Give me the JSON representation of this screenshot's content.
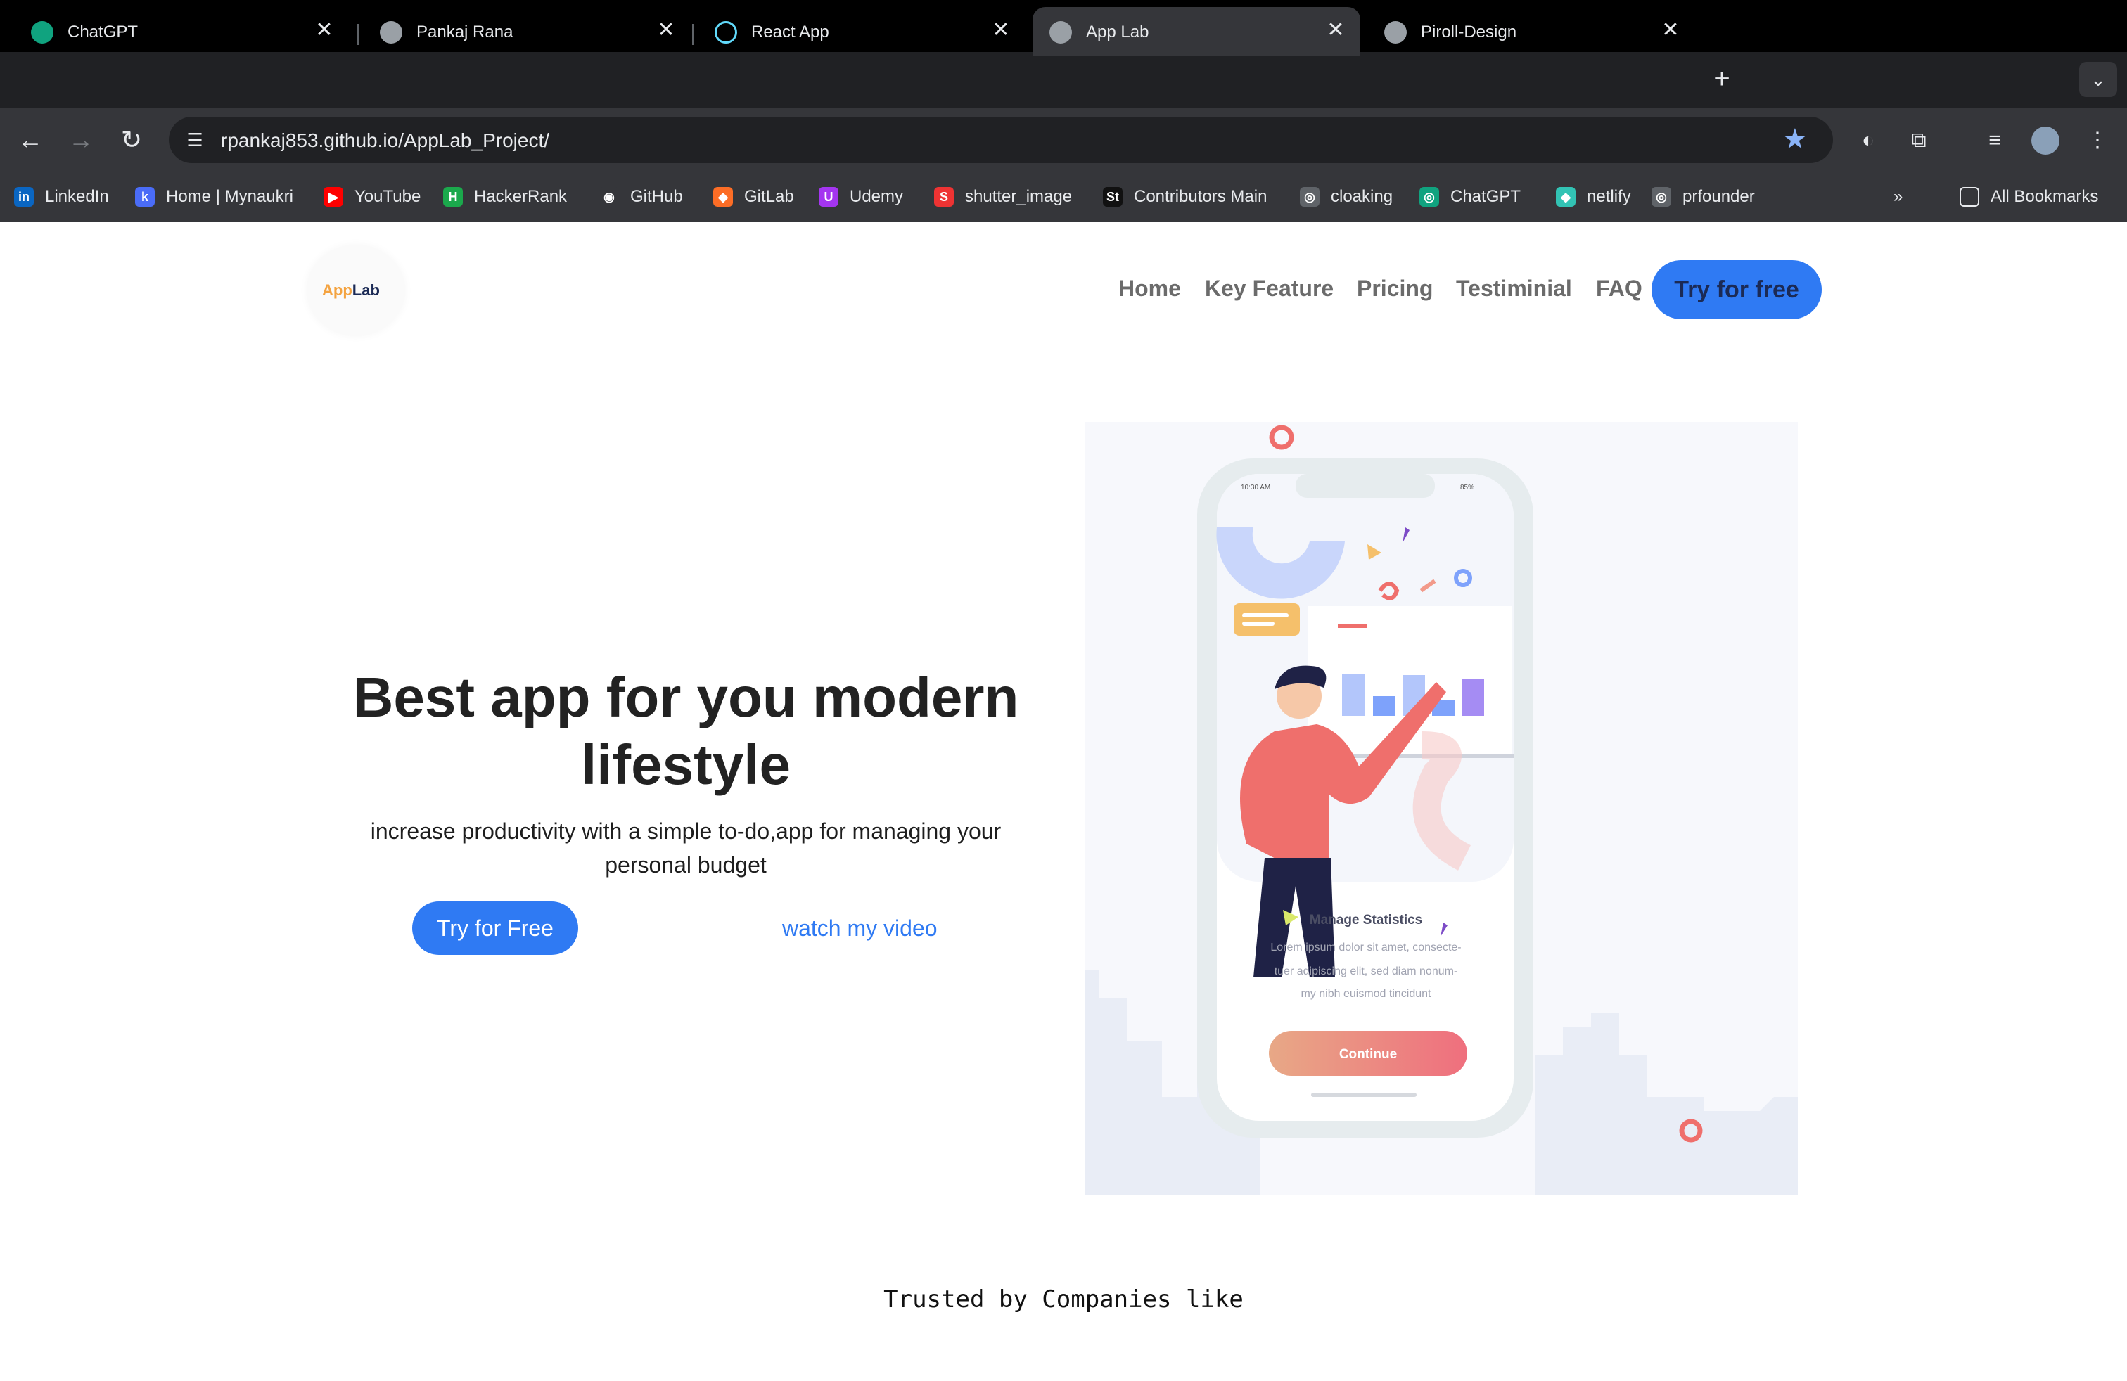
{
  "browser": {
    "tabs": [
      {
        "title": "ChatGPT",
        "favicon": "chatgpt-icon"
      },
      {
        "title": "Pankaj Rana",
        "favicon": "globe-icon"
      },
      {
        "title": "React App",
        "favicon": "react-icon"
      },
      {
        "title": "App Lab",
        "favicon": "globe-icon",
        "active": true
      },
      {
        "title": "Piroll-Design",
        "favicon": "globe-icon"
      }
    ],
    "close_glyph": "✕",
    "new_tab_glyph": "+",
    "url": "rpankaj853.github.io/AppLab_Project/",
    "bookmarks": [
      {
        "label": "LinkedIn",
        "icon": "in",
        "color": "#0a66c2"
      },
      {
        "label": "Home | Mynaukri",
        "icon": "k",
        "color": "#4a6cf7"
      },
      {
        "label": "YouTube",
        "icon": "▶",
        "color": "#ff0000"
      },
      {
        "label": "HackerRank",
        "icon": "H",
        "color": "#1ba94c"
      },
      {
        "label": "GitHub",
        "icon": "◉",
        "color": "#35363a"
      },
      {
        "label": "GitLab",
        "icon": "◆",
        "color": "#fc6d26"
      },
      {
        "label": "Udemy",
        "icon": "U",
        "color": "#a435f0"
      },
      {
        "label": "shutter_image",
        "icon": "S",
        "color": "#e33"
      },
      {
        "label": "Contributors Main",
        "icon": "St",
        "color": "#111"
      },
      {
        "label": "cloaking",
        "icon": "◎",
        "color": "#5f6368"
      },
      {
        "label": "ChatGPT",
        "icon": "◎",
        "color": "#10a37f"
      },
      {
        "label": "netlify",
        "icon": "◆",
        "color": "#32c3b4"
      },
      {
        "label": "prfounder",
        "icon": "◎",
        "color": "#5f6368"
      }
    ],
    "all_bookmarks": "All Bookmarks",
    "overflow_glyph": "»"
  },
  "site": {
    "logo": {
      "part1": "App",
      "part2": "Lab",
      "color1": "#f4a340",
      "color2": "#1b2a55"
    },
    "nav": [
      "Home",
      "Key Feature",
      "Pricing",
      "Testiminial",
      "FAQ"
    ],
    "nav_cta": "Try for free",
    "hero": {
      "title": "Best app for you modern lifestyle",
      "subtitle": "increase productivity with a simple to-do,app for managing your personal budget",
      "primary_cta": "Try for Free",
      "secondary_cta": "watch my video"
    },
    "phone": {
      "time": "10:30 AM",
      "battery": "85%",
      "card_title": "Manage Statistics",
      "card_text": "Lorem ipsum dolor sit amet, consecte-tuer adipiscing elit, sed diam nonum-my nibh euismod tincidunt",
      "button": "Continue"
    },
    "trusted": "Trusted by Companies like"
  },
  "colors": {
    "accent": "#2f7af3",
    "coral": "#ef6f6c"
  }
}
